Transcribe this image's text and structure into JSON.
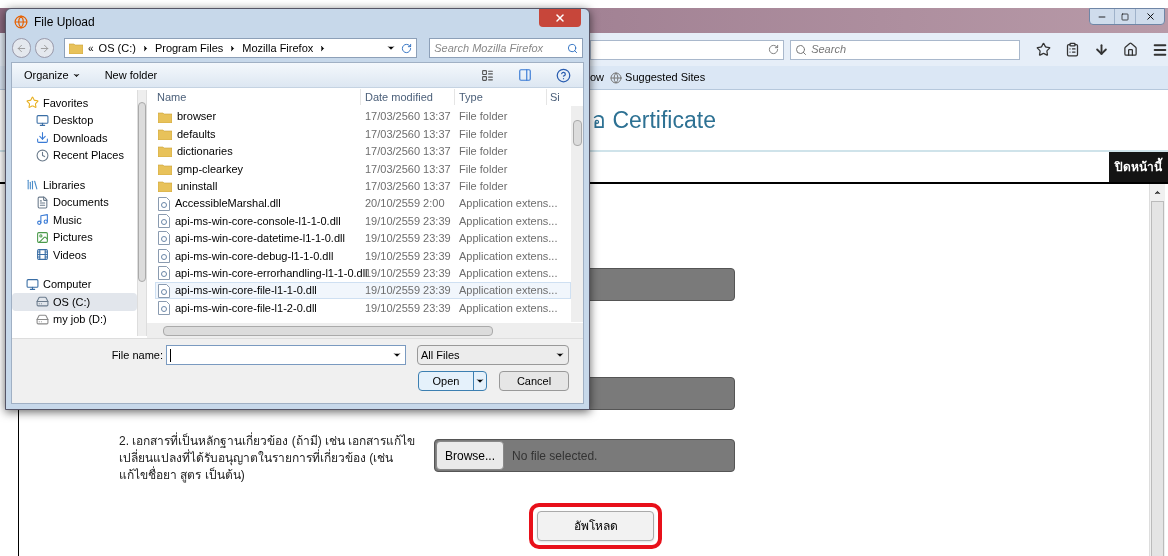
{
  "browser": {
    "search_placeholder": "Search",
    "bookmarks": [
      {
        "label": "ow"
      },
      {
        "label": "Suggested Sites"
      }
    ]
  },
  "page": {
    "heading": "อ Certificate",
    "close_button": "ปิดหน้านี้",
    "upload_fields": [
      {
        "kind": "covered"
      },
      {
        "kind": "covered"
      },
      {
        "kind": "file",
        "label": "2. เอกสารที่เป็นหลักฐานเกี่ยวข้อง (ถ้ามี) เช่น เอกสารแก้ไขเปลี่ยนแปลงที่ได้รับอนุญาตในรายการที่เกี่ยวข้อง (เช่น แก้ไขชื่อยา สูตร เป็นต้น)",
        "button": "Browse...",
        "status": "No file selected."
      }
    ],
    "upload_button": {
      "label": "อัพโหลด",
      "highlighted": true
    }
  },
  "dialog": {
    "title": "File Upload",
    "breadcrumb_overflow": "«",
    "breadcrumb": [
      "OS (C:)",
      "Program Files",
      "Mozilla Firefox"
    ],
    "search_placeholder": "Search Mozilla Firefox",
    "toolbar": [
      "Organize",
      "New folder"
    ],
    "nav": [
      {
        "label": "Favorites",
        "selected": false,
        "children": [
          {
            "label": "Desktop",
            "selected": false
          },
          {
            "label": "Downloads",
            "selected": false
          },
          {
            "label": "Recent Places",
            "selected": false
          }
        ]
      },
      {
        "label": "Libraries",
        "selected": false,
        "children": [
          {
            "label": "Documents",
            "selected": false
          },
          {
            "label": "Music",
            "selected": false
          },
          {
            "label": "Pictures",
            "selected": false
          },
          {
            "label": "Videos",
            "selected": false
          }
        ]
      },
      {
        "label": "Computer",
        "selected": false,
        "children": [
          {
            "label": "OS (C:)",
            "selected": true
          },
          {
            "label": "my job (D:)",
            "selected": false
          }
        ]
      }
    ],
    "columns": [
      "Name",
      "Date modified",
      "Type",
      "Si"
    ],
    "rows": [
      {
        "kind": "folder",
        "name": "browser",
        "date": "17/03/2560 13:37",
        "type": "File folder",
        "selected": false
      },
      {
        "kind": "folder",
        "name": "defaults",
        "date": "17/03/2560 13:37",
        "type": "File folder",
        "selected": false
      },
      {
        "kind": "folder",
        "name": "dictionaries",
        "date": "17/03/2560 13:37",
        "type": "File folder",
        "selected": false
      },
      {
        "kind": "folder",
        "name": "gmp-clearkey",
        "date": "17/03/2560 13:37",
        "type": "File folder",
        "selected": false
      },
      {
        "kind": "folder",
        "name": "uninstall",
        "date": "17/03/2560 13:37",
        "type": "File folder",
        "selected": false
      },
      {
        "kind": "file",
        "name": "AccessibleMarshal.dll",
        "date": "20/10/2559 2:00",
        "type": "Application extens...",
        "selected": false
      },
      {
        "kind": "file",
        "name": "api-ms-win-core-console-l1-1-0.dll",
        "date": "19/10/2559 23:39",
        "type": "Application extens...",
        "selected": false
      },
      {
        "kind": "file",
        "name": "api-ms-win-core-datetime-l1-1-0.dll",
        "date": "19/10/2559 23:39",
        "type": "Application extens...",
        "selected": false
      },
      {
        "kind": "file",
        "name": "api-ms-win-core-debug-l1-1-0.dll",
        "date": "19/10/2559 23:39",
        "type": "Application extens...",
        "selected": false
      },
      {
        "kind": "file",
        "name": "api-ms-win-core-errorhandling-l1-1-0.dll",
        "date": "19/10/2559 23:39",
        "type": "Application extens...",
        "selected": false
      },
      {
        "kind": "file",
        "name": "api-ms-win-core-file-l1-1-0.dll",
        "date": "19/10/2559 23:39",
        "type": "Application extens...",
        "selected": true
      },
      {
        "kind": "file",
        "name": "api-ms-win-core-file-l1-2-0.dll",
        "date": "19/10/2559 23:39",
        "type": "Application extens...",
        "selected": false
      }
    ],
    "file_name_label": "File name:",
    "file_type": "All Files",
    "buttons": {
      "open": "Open",
      "cancel": "Cancel"
    }
  }
}
